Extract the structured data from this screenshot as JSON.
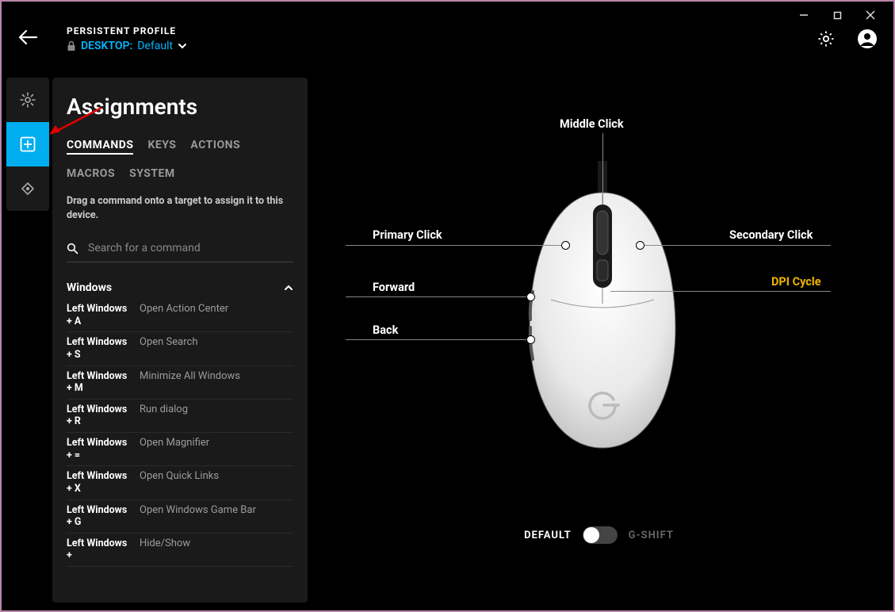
{
  "window": {
    "title_profile": "PERSISTENT PROFILE",
    "desktop_label": "DESKTOP:",
    "desktop_value": "Default"
  },
  "panel": {
    "title": "Assignments",
    "tabs": [
      "COMMANDS",
      "KEYS",
      "ACTIONS",
      "MACROS",
      "SYSTEM"
    ],
    "active_tab": 0,
    "hint": "Drag a command onto a target to assign it to this device.",
    "search_placeholder": "Search for a command",
    "group_name": "Windows",
    "commands": [
      {
        "shortcut": "Left Windows + A",
        "label": "Open Action Center"
      },
      {
        "shortcut": "Left Windows + S",
        "label": "Open Search"
      },
      {
        "shortcut": "Left Windows + M",
        "label": "Minimize All Windows"
      },
      {
        "shortcut": "Left Windows + R",
        "label": "Run dialog"
      },
      {
        "shortcut": "Left Windows + =",
        "label": "Open Magnifier"
      },
      {
        "shortcut": "Left Windows + X",
        "label": "Open Quick Links"
      },
      {
        "shortcut": "Left Windows + G",
        "label": "Open Windows Game Bar"
      },
      {
        "shortcut": "Left Windows +",
        "label": "Hide/Show"
      }
    ]
  },
  "mouse_labels": {
    "middle": "Middle Click",
    "primary": "Primary Click",
    "secondary": "Secondary Click",
    "forward": "Forward",
    "back": "Back",
    "dpi": "DPI Cycle"
  },
  "toggle": {
    "left": "DEFAULT",
    "right": "G-SHIFT"
  }
}
